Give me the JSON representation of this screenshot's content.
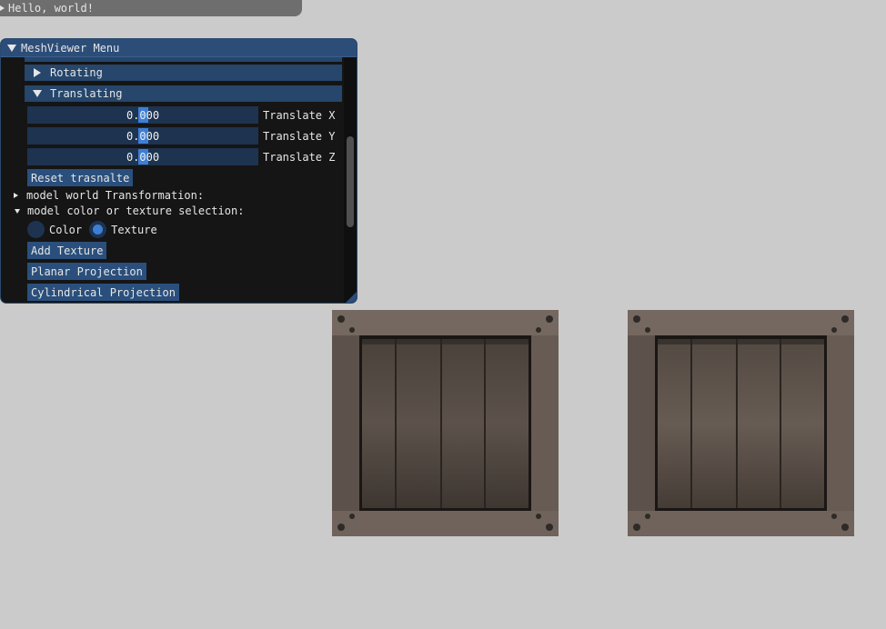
{
  "hello_window": {
    "title": "Hello, world!"
  },
  "menu": {
    "title": "MeshViewer Menu",
    "headers": [
      {
        "label": "Rotating",
        "expanded": false
      },
      {
        "label": "Translating",
        "expanded": true
      }
    ],
    "translate": [
      {
        "value": "0.000",
        "label": "Translate X"
      },
      {
        "value": "0.000",
        "label": "Translate Y"
      },
      {
        "value": "0.000",
        "label": "Translate Z"
      }
    ],
    "reset_button": "Reset trasnalte",
    "tree_world": "model world Transformation:",
    "tree_color": "model color or texture selection:",
    "radio": {
      "color_label": "Color",
      "texture_label": "Texture",
      "selected": "Texture"
    },
    "add_texture_button": "Add Texture",
    "planar_button": "Planar Projection",
    "cylindrical_button": "Cylindrical Projection"
  },
  "colors": {
    "background": "#cbcbcb",
    "window_bg": "#151515",
    "title_bg": "#2c4d78",
    "header_bg": "#26466b",
    "accent": "#3d7fd6"
  }
}
